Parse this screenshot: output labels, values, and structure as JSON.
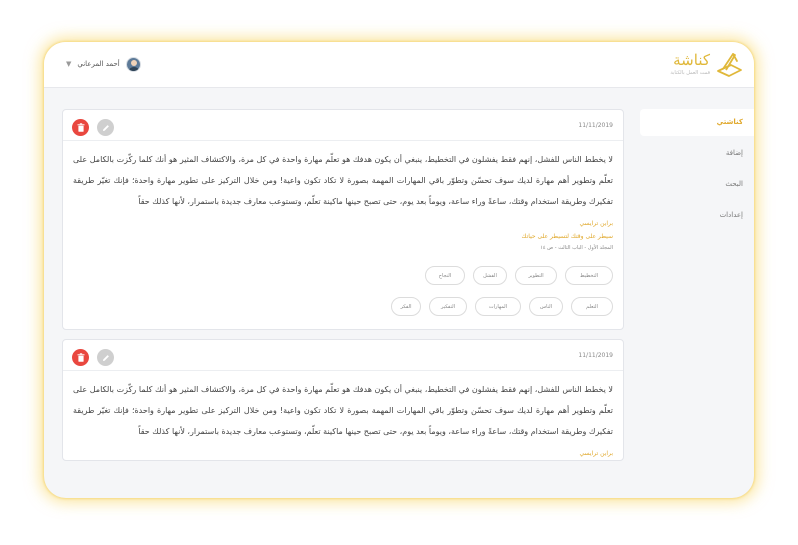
{
  "header": {
    "username": "أحمد المرعاني",
    "logo_name": "كناشة",
    "logo_tagline": "قمت العمل بالكتابة"
  },
  "sidebar": {
    "items": [
      {
        "label": "كناشتي",
        "active": true
      },
      {
        "label": "إضافة",
        "active": false
      },
      {
        "label": "البحث",
        "active": false
      },
      {
        "label": "إعدادات",
        "active": false
      }
    ]
  },
  "cards": [
    {
      "date": "11/11/2019",
      "body": "لا يخطط الناس للفشل، إنهم فقط يفشلون في التخطيط، ينبغي أن يكون هدفك هو تعلّم مهارة واحدة في كل مرة، والاكتشاف المثير هو أنك كلما ركّزت بالكامل على تعلّم وتطوير أهم مهارة لديك سوف تحسّن وتطوّر باقي المهارات المهمة بصورة لا تكاد تكون واعية! ومن خلال التركيز على تطوير مهارة واحدة؛ فإنك تغيّر طريقة تفكيرك وطريقة استخدام وقتك، ساعةً وراء ساعة، ويوماً بعد يوم، حتى تصبح حينها ماكينة تعلّم، وتستوعب معارف جديدة باستمرار، لأنها كذلك حقاً",
      "author": "براين ترايسي",
      "source": "سيطر على وقتك لتسيطر على حياتك",
      "meta": "المجلد الأول  -  الباب الثالث  -  ص ١٤",
      "tags_row1": [
        "التخطيط",
        "التطوير",
        "الفشل",
        "النجاح"
      ],
      "tags_row2": [
        "التعلم",
        "الناس",
        "المهارات",
        "التفكير",
        "الفكر"
      ]
    },
    {
      "date": "11/11/2019",
      "body": "لا يخطط الناس للفشل، إنهم فقط يفشلون في التخطيط، ينبغي أن يكون هدفك هو تعلّم مهارة واحدة في كل مرة، والاكتشاف المثير هو أنك كلما ركّزت بالكامل على تعلّم وتطوير أهم مهارة لديك سوف تحسّن وتطوّر باقي المهارات المهمة بصورة لا تكاد تكون واعية! ومن خلال التركيز على تطوير مهارة واحدة؛ فإنك تغيّر طريقة تفكيرك وطريقة استخدام وقتك، ساعةً وراء ساعة، ويوماً بعد يوم، حتى تصبح حينها ماكينة تعلّم، وتستوعب معارف جديدة باستمرار، لأنها كذلك حقاً",
      "author": "براين ترايسي"
    }
  ],
  "colors": {
    "accent": "#e0a82b",
    "delete": "#e9473f",
    "frame_glow": "#f8d660"
  }
}
